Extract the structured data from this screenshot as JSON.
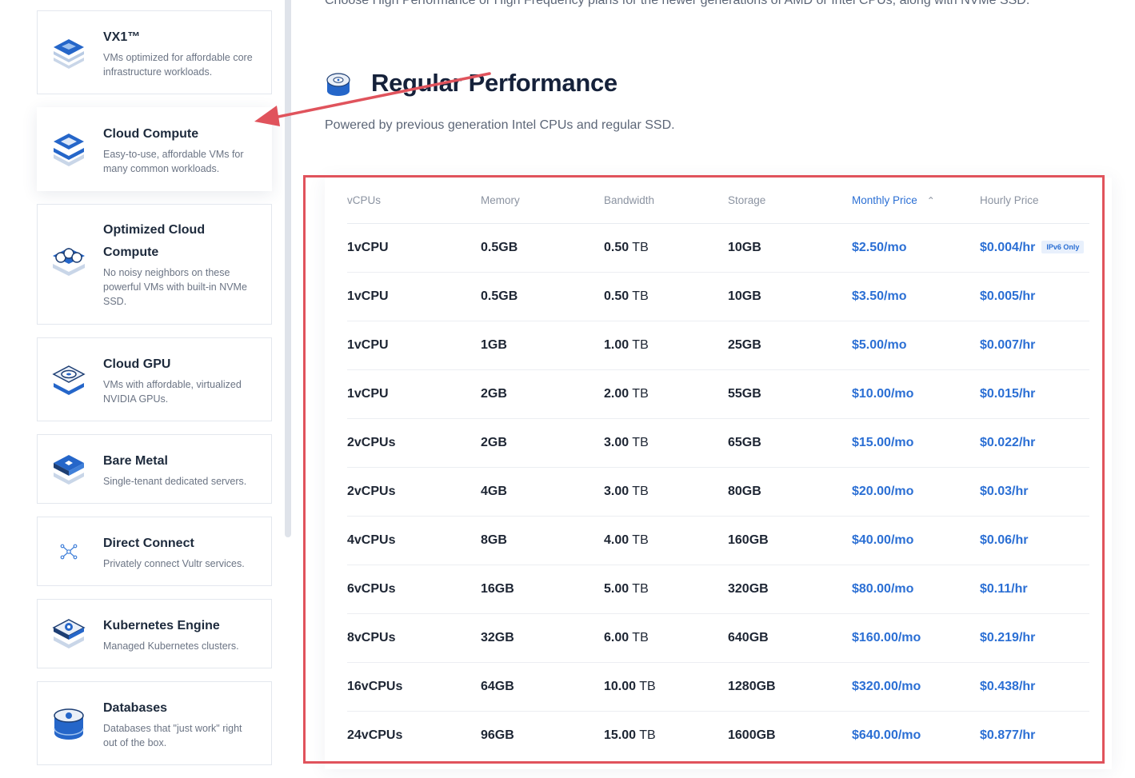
{
  "intro_text": "Choose High Performance or High Frequency plans for the newer generations of AMD or Intel CPUs, along with NVMe SSD.",
  "section": {
    "title": "Regular Performance",
    "subtitle": "Powered by previous generation Intel CPUs and regular SSD.",
    "icon": "disk-icon"
  },
  "sidebar": {
    "items": [
      {
        "title": "VX1™",
        "desc": "VMs optimized for affordable core infrastructure workloads.",
        "icon": "vx1-stack-icon"
      },
      {
        "title": "Cloud Compute",
        "desc": "Easy-to-use, affordable VMs for many common workloads.",
        "icon": "cloud-compute-icon",
        "active": true
      },
      {
        "title": "Optimized Cloud Compute",
        "desc": "No noisy neighbors on these powerful VMs with built-in NVMe SSD.",
        "icon": "optimized-compute-icon"
      },
      {
        "title": "Cloud GPU",
        "desc": "VMs with affordable, virtualized NVIDIA GPUs.",
        "icon": "gpu-icon"
      },
      {
        "title": "Bare Metal",
        "desc": "Single-tenant dedicated servers.",
        "icon": "bare-metal-icon"
      },
      {
        "title": "Direct Connect",
        "desc": "Privately connect Vultr services.",
        "icon": "network-icon"
      },
      {
        "title": "Kubernetes Engine",
        "desc": "Managed Kubernetes clusters.",
        "icon": "kubernetes-icon"
      },
      {
        "title": "Databases",
        "desc": "Databases that \"just work\" right out of the box.",
        "icon": "database-icon"
      }
    ]
  },
  "table": {
    "headers": {
      "vcpus": "vCPUs",
      "memory": "Memory",
      "bandwidth": "Bandwidth",
      "storage": "Storage",
      "monthly": "Monthly Price",
      "hourly": "Hourly Price"
    },
    "badge": "IPv6 Only",
    "rows": [
      {
        "vcpus": "1vCPU",
        "memory": "0.5GB",
        "bw_num": "0.50",
        "bw_unit": "TB",
        "storage": "10GB",
        "monthly": "$2.50/mo",
        "hourly": "$0.004/hr",
        "badge": true
      },
      {
        "vcpus": "1vCPU",
        "memory": "0.5GB",
        "bw_num": "0.50",
        "bw_unit": "TB",
        "storage": "10GB",
        "monthly": "$3.50/mo",
        "hourly": "$0.005/hr"
      },
      {
        "vcpus": "1vCPU",
        "memory": "1GB",
        "bw_num": "1.00",
        "bw_unit": "TB",
        "storage": "25GB",
        "monthly": "$5.00/mo",
        "hourly": "$0.007/hr"
      },
      {
        "vcpus": "1vCPU",
        "memory": "2GB",
        "bw_num": "2.00",
        "bw_unit": "TB",
        "storage": "55GB",
        "monthly": "$10.00/mo",
        "hourly": "$0.015/hr"
      },
      {
        "vcpus": "2vCPUs",
        "memory": "2GB",
        "bw_num": "3.00",
        "bw_unit": "TB",
        "storage": "65GB",
        "monthly": "$15.00/mo",
        "hourly": "$0.022/hr"
      },
      {
        "vcpus": "2vCPUs",
        "memory": "4GB",
        "bw_num": "3.00",
        "bw_unit": "TB",
        "storage": "80GB",
        "monthly": "$20.00/mo",
        "hourly": "$0.03/hr"
      },
      {
        "vcpus": "4vCPUs",
        "memory": "8GB",
        "bw_num": "4.00",
        "bw_unit": "TB",
        "storage": "160GB",
        "monthly": "$40.00/mo",
        "hourly": "$0.06/hr"
      },
      {
        "vcpus": "6vCPUs",
        "memory": "16GB",
        "bw_num": "5.00",
        "bw_unit": "TB",
        "storage": "320GB",
        "monthly": "$80.00/mo",
        "hourly": "$0.11/hr"
      },
      {
        "vcpus": "8vCPUs",
        "memory": "32GB",
        "bw_num": "6.00",
        "bw_unit": "TB",
        "storage": "640GB",
        "monthly": "$160.00/mo",
        "hourly": "$0.219/hr"
      },
      {
        "vcpus": "16vCPUs",
        "memory": "64GB",
        "bw_num": "10.00",
        "bw_unit": "TB",
        "storage": "1280GB",
        "monthly": "$320.00/mo",
        "hourly": "$0.438/hr"
      },
      {
        "vcpus": "24vCPUs",
        "memory": "96GB",
        "bw_num": "15.00",
        "bw_unit": "TB",
        "storage": "1600GB",
        "monthly": "$640.00/mo",
        "hourly": "$0.877/hr"
      }
    ]
  },
  "colors": {
    "accent": "#2b6fd4",
    "highlight": "#e0535c"
  }
}
